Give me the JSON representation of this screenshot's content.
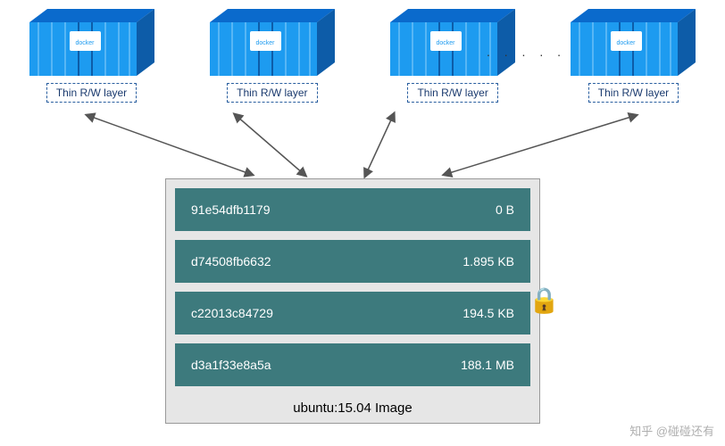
{
  "containers": [
    {
      "rw_label": "Thin R/W layer"
    },
    {
      "rw_label": "Thin R/W layer"
    },
    {
      "rw_label": "Thin R/W layer"
    },
    {
      "rw_label": "Thin R/W layer"
    }
  ],
  "ellipsis": ". . . . .",
  "image": {
    "label": "ubuntu:15.04 Image",
    "layers": [
      {
        "id": "91e54dfb1179",
        "size": "0 B"
      },
      {
        "id": "d74508fb6632",
        "size": "1.895 KB"
      },
      {
        "id": "c22013c84729",
        "size": "194.5 KB"
      },
      {
        "id": "d3a1f33e8a5a",
        "size": "188.1 MB"
      }
    ]
  },
  "brand": "docker",
  "watermark": "知乎 @碰碰还有"
}
